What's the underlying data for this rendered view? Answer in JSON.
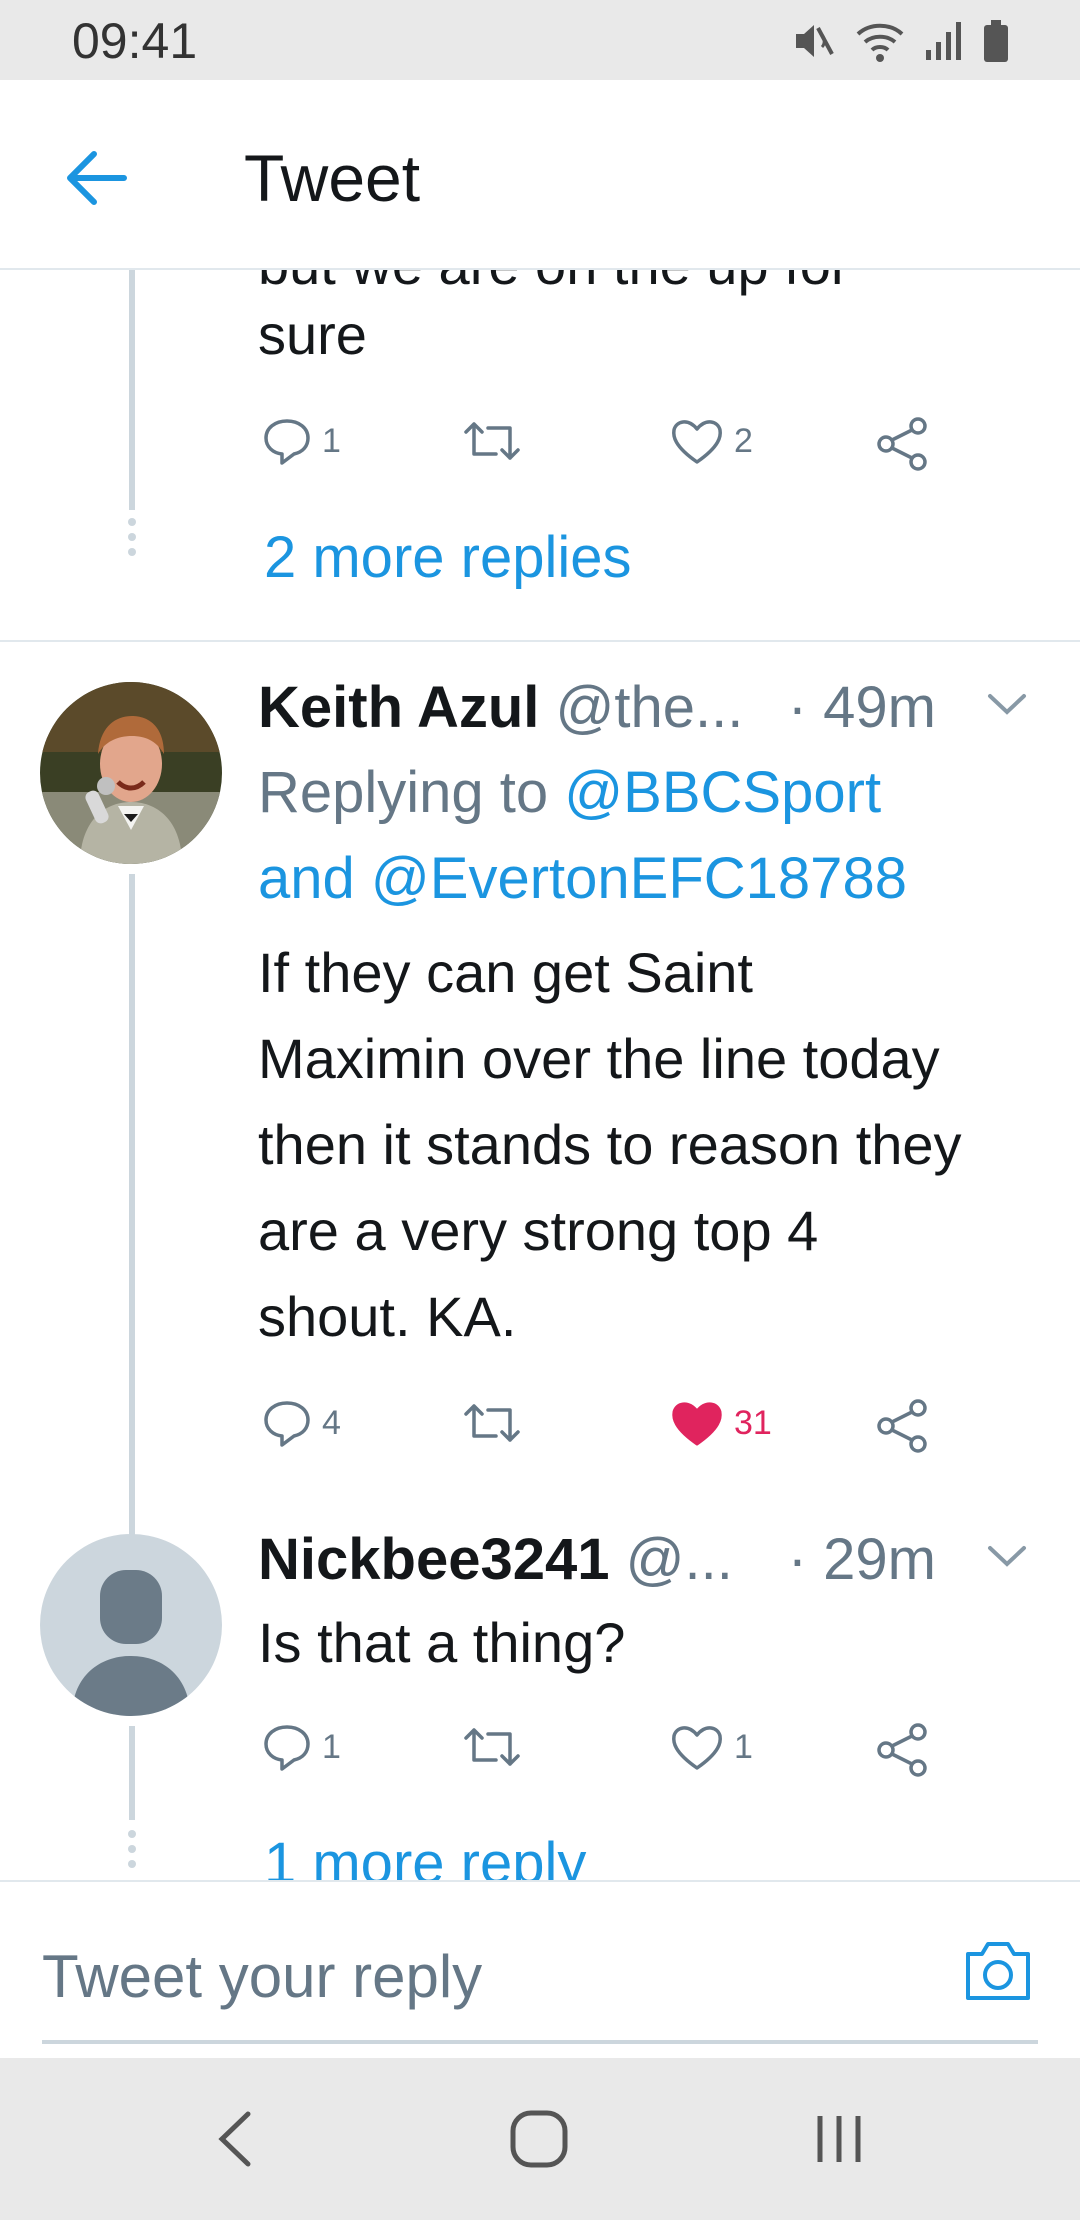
{
  "status_bar": {
    "time": "09:41"
  },
  "header": {
    "title": "Tweet"
  },
  "tweets": {
    "prev": {
      "cut_text": "but we are on the up for",
      "text": "sure",
      "reply_count": "1",
      "like_count": "2",
      "more_replies": "2 more replies"
    },
    "keith": {
      "name": "Keith Azul",
      "handle": "@the...",
      "time": "· 49m",
      "replying_prefix": "Replying to",
      "mention1": "@BBCSport",
      "and": "and",
      "mention2": "@EvertonEFC18788",
      "text": "If they can get Saint Maximin over the line today then it stands to reason they are a very strong top 4 shout. KA.",
      "reply_count": "4",
      "like_count": "31"
    },
    "nick": {
      "name": "Nickbee3241",
      "handle": "@...",
      "time": "· 29m",
      "text": "Is that a thing?",
      "reply_count": "1",
      "like_count": "1",
      "more_replies": "1 more reply"
    }
  },
  "reply_bar": {
    "placeholder": "Tweet your reply"
  },
  "colors": {
    "accent": "#1b95e0",
    "like": "#e0245e",
    "muted": "#657786",
    "line": "#ccd6dd"
  },
  "icons": [
    "back-arrow-icon",
    "reply-icon",
    "retweet-icon",
    "like-icon",
    "share-icon",
    "chevron-down-icon",
    "camera-icon",
    "nav-back-icon",
    "nav-home-icon",
    "nav-recents-icon"
  ]
}
